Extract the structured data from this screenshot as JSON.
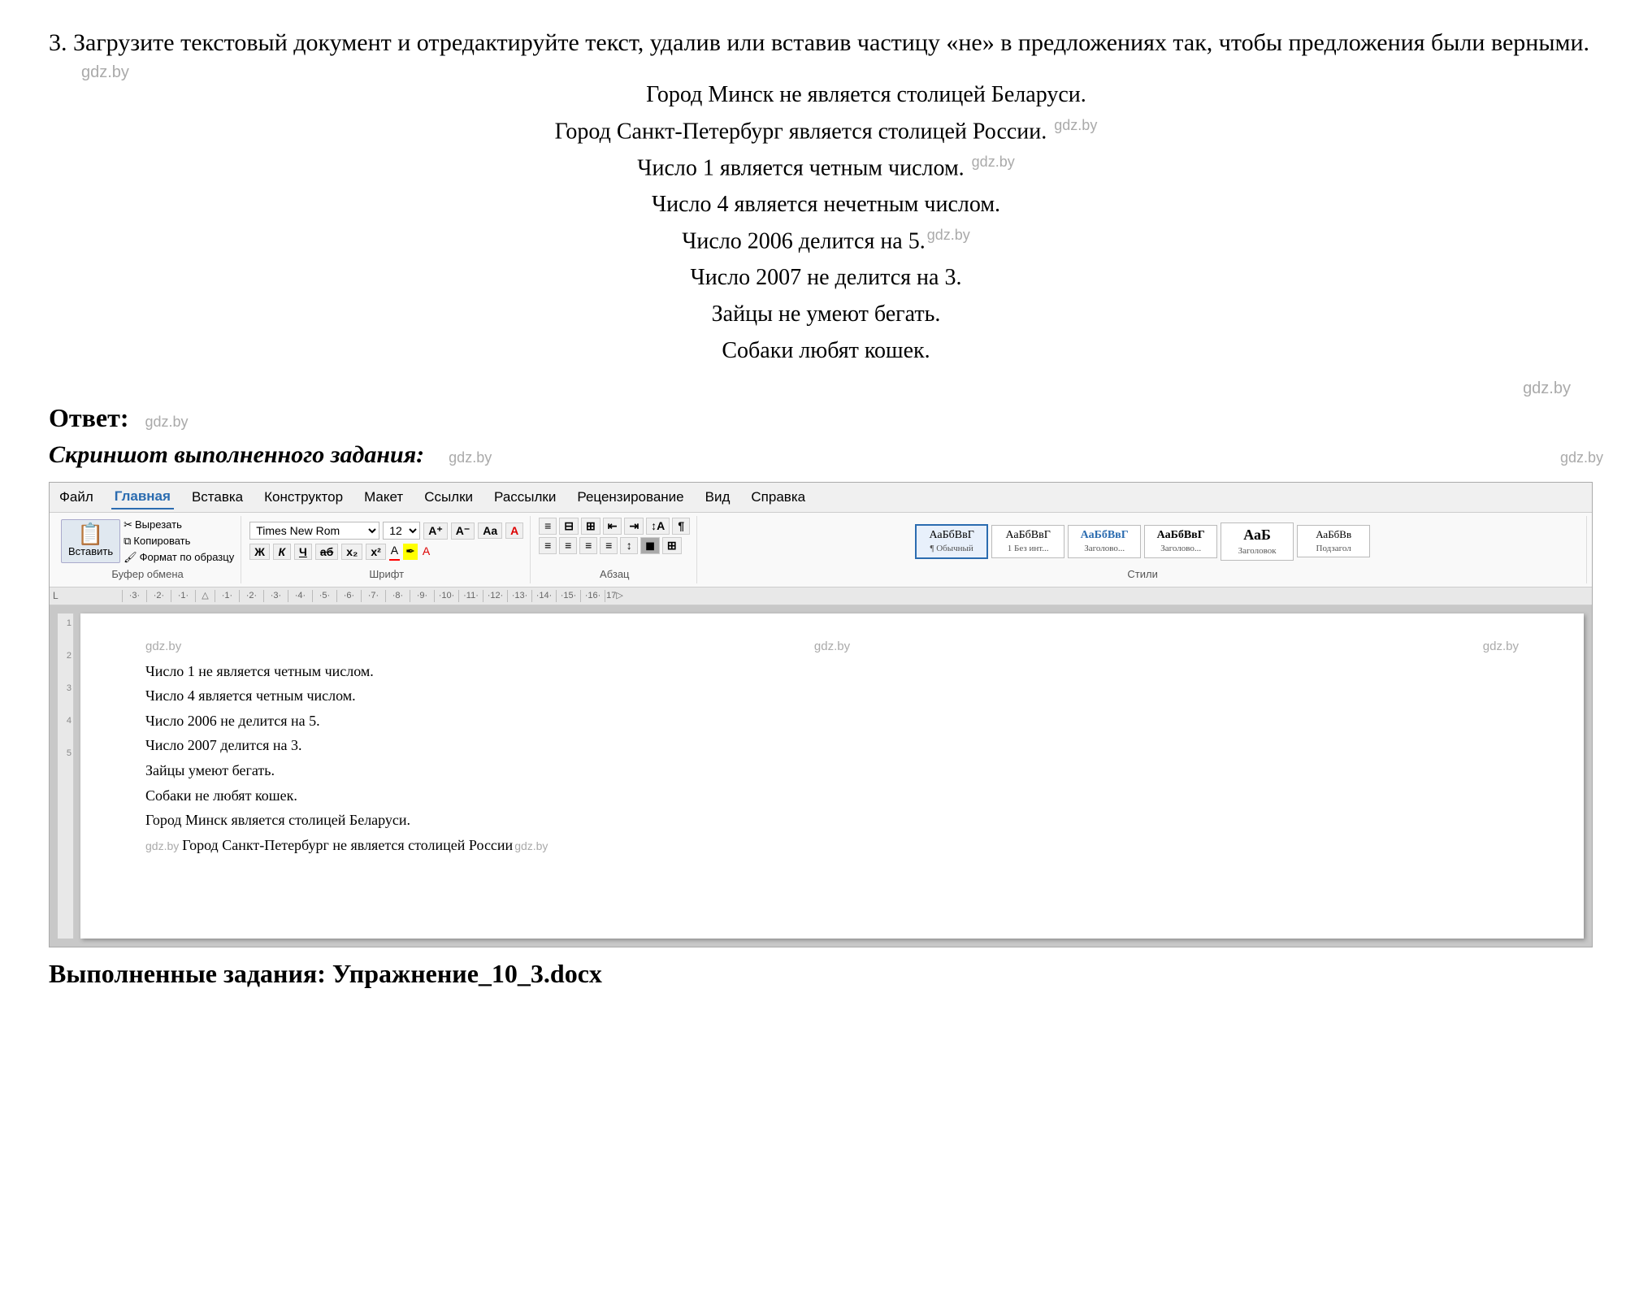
{
  "task": {
    "number": "3.",
    "description": "Загрузите текстовый документ и отредактируйте текст, удалив или вставив частицу «не» в предложениях так, чтобы предложения были верными.",
    "sentences": [
      "Город Минск не является столицей Беларуси.",
      "Город Санкт-Петербург является столицей России.",
      "Число 1 является четным числом.",
      "Число 4 является нечетным числом.",
      "Число 2006 делится на 5.",
      "Число 2007 не делится на 3.",
      "Зайцы не умеют бегать.",
      "Собаки любят кошек."
    ]
  },
  "watermarks": [
    "gdz.by",
    "gdz.by",
    "gdz.by",
    "gdz.by",
    "gdz.by",
    "gdz.by",
    "gdz.by",
    "gdz.by"
  ],
  "answer": {
    "label": "Ответ:",
    "screenshot_label": "Скриншот выполненного задания:"
  },
  "menu": {
    "items": [
      "Файл",
      "Главная",
      "Вставка",
      "Конструктор",
      "Макет",
      "Ссылки",
      "Рассылки",
      "Рецензирование",
      "Вид",
      "Справка"
    ]
  },
  "ribbon": {
    "paste_label": "Вставить",
    "clipboard_group": "Буфер обмена",
    "cut_label": "Вырезать",
    "copy_label": "Копировать",
    "format_painter_label": "Формат по образцу",
    "font_name": "Times New Rom",
    "font_size": "12",
    "font_group_label": "Шрифт",
    "bold_label": "Ж",
    "italic_label": "К",
    "underline_label": "Ч",
    "strikethrough_label": "аб",
    "subscript_label": "x₂",
    "superscript_label": "x²",
    "paragraph_group_label": "Абзац",
    "styles_group_label": "Стили",
    "styles": [
      {
        "label": "¶ Обычный",
        "sublabel": "1 Обычный"
      },
      {
        "label": "АаБбВвГ",
        "sublabel": "1 Без инт..."
      },
      {
        "label": "АаБбВвГ",
        "sublabel": "Заголово..."
      },
      {
        "label": "АаБбВвГ",
        "sublabel": "Заголово..."
      },
      {
        "label": "АаБ",
        "sublabel": "Заголовок"
      },
      {
        "label": "АаБбВв",
        "sublabel": "Подзагол"
      }
    ]
  },
  "ruler": {
    "numbers": [
      "-3",
      "-2",
      "-1",
      "1",
      "2",
      "3",
      "4",
      "5",
      "6",
      "7",
      "8",
      "9",
      "10",
      "11",
      "12",
      "13",
      "14",
      "15",
      "16",
      "17"
    ]
  },
  "doc": {
    "watermarks_top": [
      "gdz.by",
      "gdz.by",
      "gdz.by"
    ],
    "content_lines": [
      "Число 1 не является четным числом.",
      "Число 4 является четным числом.",
      "Число 2006 не делится на 5.",
      "Число 2007 делится на 3.",
      "Зайцы умеют бегать.",
      "Собаки не любят кошек.",
      "Город Минск является столицей Беларуси.",
      "Город Санкт-Петербург не является столицей России"
    ],
    "watermarks_bottom": [
      "gdz.by",
      "gdz.by"
    ]
  },
  "bottom": {
    "label": "Выполненные задания: Упражнение_10_3.docx"
  }
}
